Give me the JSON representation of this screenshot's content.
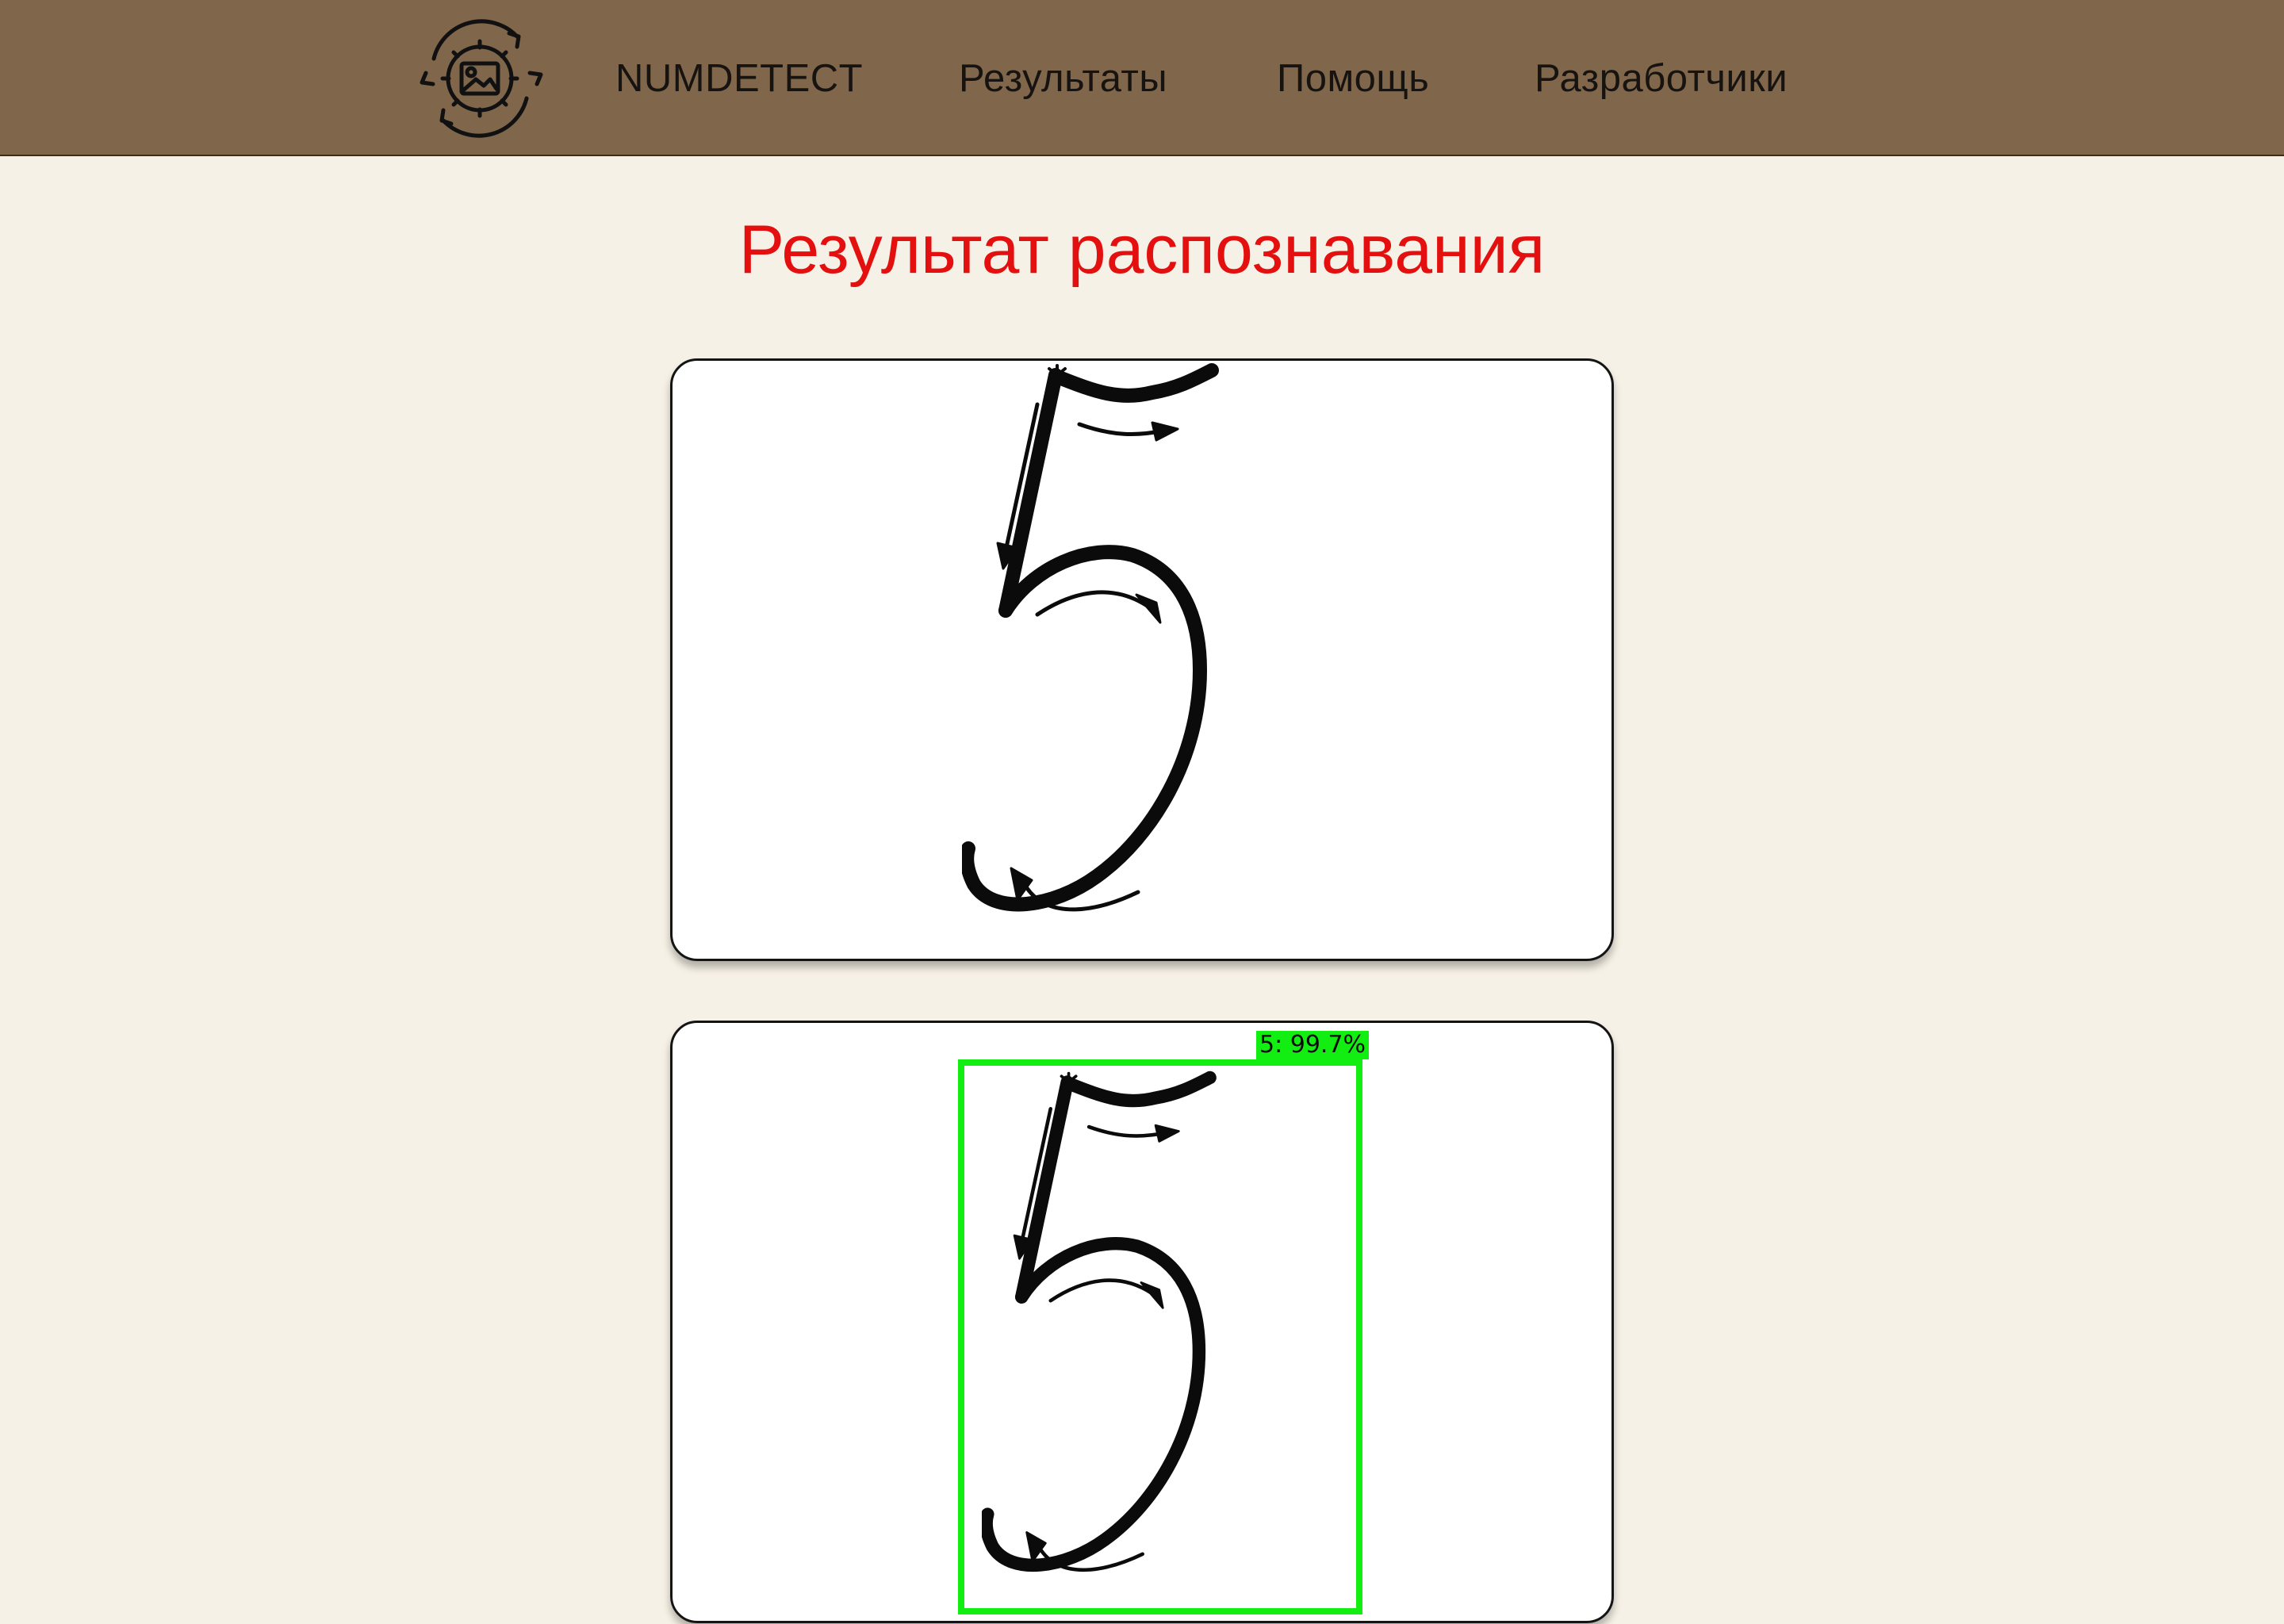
{
  "header": {
    "logo_icon": "gear-image-refresh-icon",
    "brand": "NUMDETECT",
    "nav": {
      "results": "Результаты",
      "help": "Помощь",
      "developers": "Разработчики"
    },
    "background_color": "#80664a"
  },
  "main": {
    "title": "Результат распознавания",
    "title_color": "#e3100f",
    "original_image": {
      "content": "handwritten-digit-5-with-stroke-arrows"
    },
    "result_image": {
      "content": "handwritten-digit-5-with-stroke-arrows",
      "detection": {
        "label": "5: 99.7%",
        "box_color": "#12ee12"
      }
    }
  },
  "page_background": "#f6f1e6"
}
